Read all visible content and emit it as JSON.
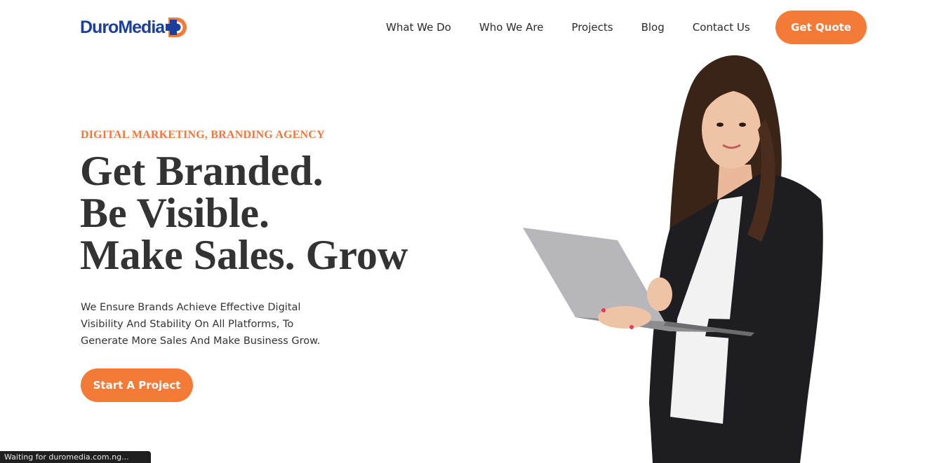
{
  "brand": {
    "name": "DuroMedia",
    "logo_letter": "D"
  },
  "nav": {
    "items": [
      {
        "label": "What We Do"
      },
      {
        "label": "Who We Are"
      },
      {
        "label": "Projects"
      },
      {
        "label": "Blog"
      },
      {
        "label": "Contact Us"
      }
    ],
    "quote_label": "Get Quote"
  },
  "hero": {
    "eyebrow": "DIGITAL MARKETING, BRANDING AGENCY",
    "headline": [
      "Get Branded.",
      "Be Visible.",
      "Make Sales. Grow"
    ],
    "description": "We Ensure Brands Achieve Effective Digital Visibility And Stability On All Platforms, To Generate More Sales And Make Business Grow.",
    "cta_label": "Start A Project"
  },
  "status_bar": {
    "text": "Waiting for duromedia.com.ng..."
  },
  "colors": {
    "accent": "#f47a37",
    "brand_blue": "#1b3f9c",
    "text": "#333333"
  }
}
